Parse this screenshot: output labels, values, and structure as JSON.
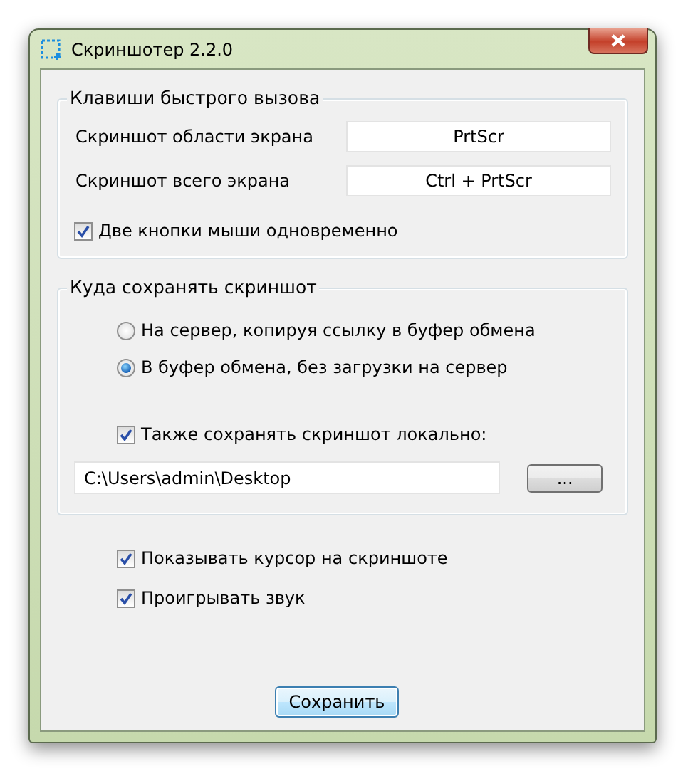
{
  "window": {
    "title": "Скриншотер 2.2.0"
  },
  "hotkeys": {
    "title": "Клавиши быстрого вызова",
    "rows": [
      {
        "label": "Скриншот области экрана",
        "value": "PrtScr"
      },
      {
        "label": "Скриншот всего экрана",
        "value": "Ctrl + PrtScr"
      }
    ],
    "both_mouse_buttons": {
      "label": "Две кнопки мыши одновременно",
      "checked": true
    }
  },
  "save_location": {
    "title": "Куда сохранять скриншот",
    "options": [
      {
        "label": "На сервер, копируя ссылку в буфер обмена",
        "selected": false
      },
      {
        "label": "В буфер обмена, без загрузки на сервер",
        "selected": true
      }
    ],
    "save_locally": {
      "label": "Также сохранять скриншот локально:",
      "checked": true
    },
    "path": {
      "value": "C:\\Users\\admin\\Desktop"
    },
    "browse_button": "..."
  },
  "options": [
    {
      "label": "Показывать курсор на скриншоте",
      "checked": true
    },
    {
      "label": "Проигрывать звук",
      "checked": true
    }
  ],
  "save_button": "Сохранить"
}
